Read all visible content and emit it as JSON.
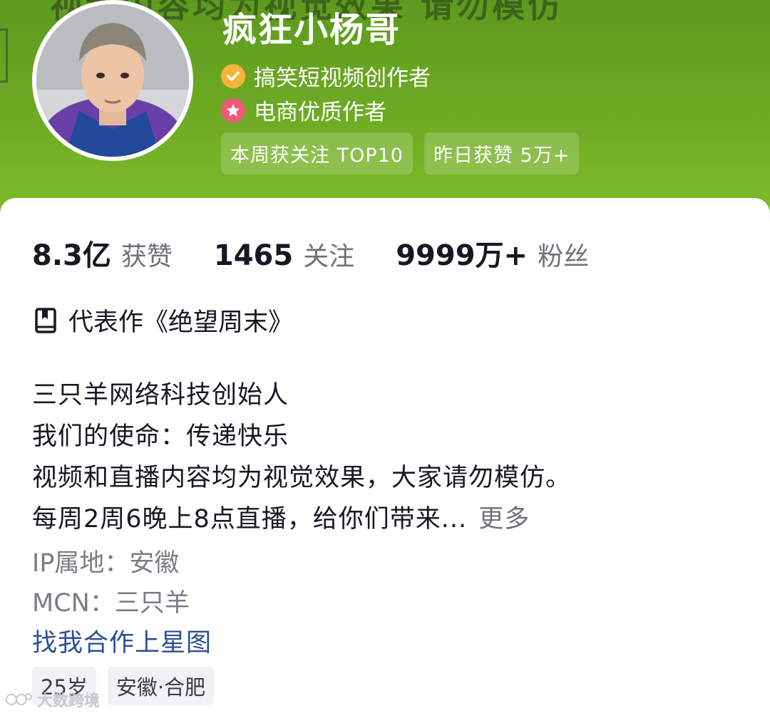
{
  "banner": {
    "background_text": "视频内容均为视觉效果 请勿模仿",
    "color": "#6eab24"
  },
  "profile": {
    "username": "疯狂小杨哥",
    "badges": [
      {
        "label": "搞笑短视频创作者",
        "icon": "check-badge-icon",
        "color": "#f4b43a"
      },
      {
        "label": "电商优质作者",
        "icon": "star-badge-icon",
        "color": "#f05a78"
      }
    ],
    "pills": [
      "本周获关注 TOP10",
      "昨日获赞 5万+"
    ]
  },
  "stats": [
    {
      "value": "8.3亿",
      "label": "获赞"
    },
    {
      "value": "1465",
      "label": "关注"
    },
    {
      "value": "9999万+",
      "label": "粉丝"
    }
  ],
  "representative_work": {
    "icon": "book-icon",
    "text": "代表作《绝望周末》"
  },
  "bio": {
    "lines": [
      "三只羊网络科技创始人",
      "我们的使命：传递快乐",
      "视频和直播内容均为视觉效果，大家请勿模仿。",
      "每周2周6晚上8点直播，给你们带来..."
    ],
    "more_label": "更多"
  },
  "meta": {
    "ip_location": "IP属地：安徽",
    "mcn": "MCN：三只羊",
    "cooperation_link": "找我合作上星图"
  },
  "tags": [
    "25岁",
    "安徽·合肥"
  ],
  "watermark": "大数跨境"
}
